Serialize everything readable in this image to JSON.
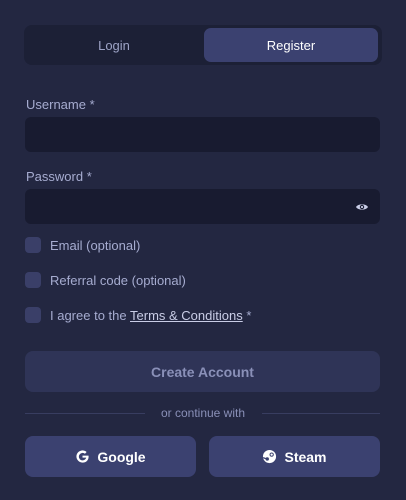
{
  "tabs": {
    "login": "Login",
    "register": "Register",
    "active": "register"
  },
  "form": {
    "username_label": "Username *",
    "username_value": "",
    "password_label": "Password *",
    "password_value": "",
    "email_option": "Email (optional)",
    "referral_option": "Referral code (optional)",
    "agree_prefix": "I agree to the",
    "terms_link": "Terms & Conditions",
    "agree_suffix": "*",
    "create_button": "Create Account"
  },
  "divider": "or continue with",
  "social": {
    "google": "Google",
    "steam": "Steam"
  },
  "icons": {
    "password_toggle": "eye-icon",
    "google": "google-icon",
    "steam": "steam-icon"
  },
  "colors": {
    "background": "#232741",
    "active_tab": "#3b4170",
    "input_bg": "#181b30",
    "social_button": "#3b4170",
    "create_button": "#2f3457"
  }
}
